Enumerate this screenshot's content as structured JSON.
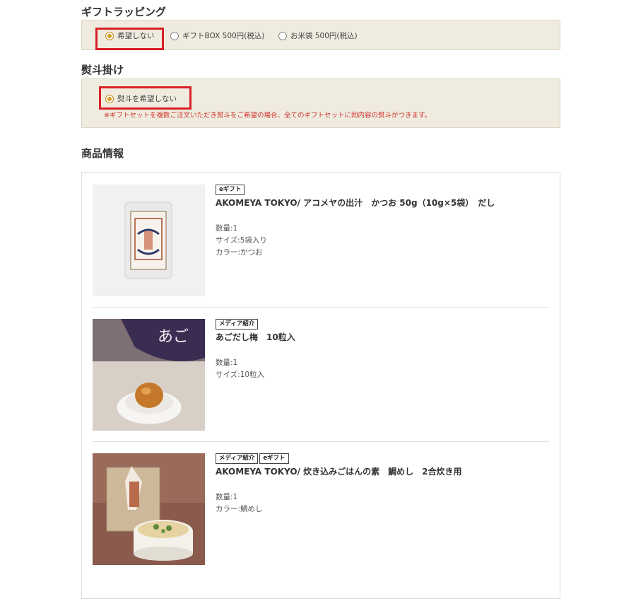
{
  "gift_wrapping": {
    "title": "ギフトラッピング",
    "options": [
      {
        "label": "希望しない",
        "checked": true
      },
      {
        "label": "ギフトBOX 500円(税込)",
        "checked": false
      },
      {
        "label": "お米袋 500円(税込)",
        "checked": false
      }
    ]
  },
  "noshi": {
    "title": "熨斗掛け",
    "option": {
      "label": "熨斗を希望しない",
      "checked": true
    },
    "note": "※ギフトセットを複数ご注文いただき熨斗をご希望の場合、全てのギフトセットに同内容の熨斗がつきます。"
  },
  "products_section": {
    "title": "商品情報",
    "items": [
      {
        "badges": [
          "eギフト"
        ],
        "name": "AKOMEYA TOKYO/ アコメヤの出汁　かつお 50g（10g×5袋）　だし",
        "meta": [
          "数量:1",
          "サイズ:5袋入り",
          "カラー:かつお"
        ],
        "thumb_icon": "dashi-pack-image"
      },
      {
        "badges": [
          "メディア紹介"
        ],
        "name": "あごだし梅　10粒入",
        "meta": [
          "数量:1",
          "サイズ:10粒入"
        ],
        "thumb_icon": "umeboshi-image"
      },
      {
        "badges": [
          "メディア紹介",
          "eギフト"
        ],
        "name": "AKOMEYA TOKYO/ 炊き込みごはんの素　鯛めし　2合炊き用",
        "meta": [
          "数量:1",
          "カラー:鯛めし"
        ],
        "thumb_icon": "taimeshi-image"
      }
    ]
  },
  "colors": {
    "accent": "#d79b1f",
    "highlight": "#d92027",
    "note": "#d0302a",
    "panel": "#efebdf"
  }
}
